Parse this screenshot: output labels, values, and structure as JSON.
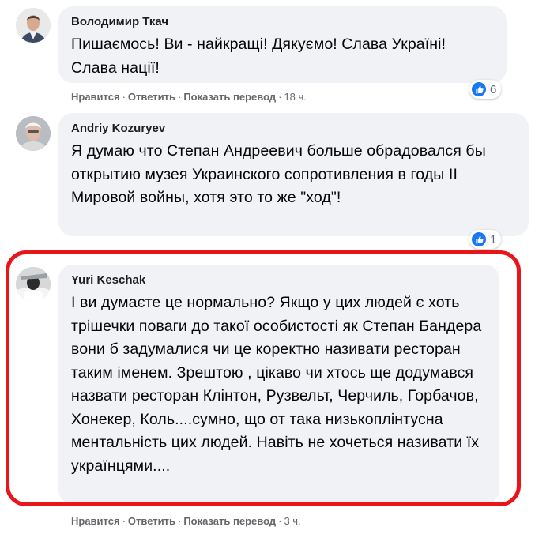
{
  "comments": [
    {
      "author": "Володимир Ткач",
      "text": "Пишаємось! Ви - найкращі! Дякуємо! Слава Україні! Слава нації!",
      "actions": {
        "like": "Нравится",
        "reply": "Ответить",
        "translate": "Показать перевод",
        "time": "18 ч."
      },
      "reaction_count": "6"
    },
    {
      "author": "Andriy Kozuryev",
      "text": "Я думаю что Степан Андреевич больше обрадовался бы открытию музея Украинского сопротивления в годы II Мировой войны, хотя это то же \"ход\"!",
      "reaction_count": "1"
    },
    {
      "author": "Yuri Keschak",
      "text": "І ви думаєте це нормально? Якщо у цих людей є хоть трішечки поваги до такої особистості як Степан Бандера вони б задумалися чи це коректно називати ресторан таким іменем. Зрештою , цікаво чи хтось ще додумався назвати ресторан Клінтон, Рузвельт, Черчиль, Горбачов, Хонекер, Коль....сумно, що от така низькоплінтусна ментальність цих людей. Навіть не хочеться називати їх українцями....",
      "actions": {
        "like": "Нравится",
        "reply": "Ответить",
        "translate": "Показать перевод",
        "time": "3 ч."
      }
    }
  ],
  "separator": "·",
  "colors": {
    "highlight": "#e8151a",
    "bubble": "#f0f2f5",
    "like": "#1877f2",
    "meta": "#65676b"
  }
}
